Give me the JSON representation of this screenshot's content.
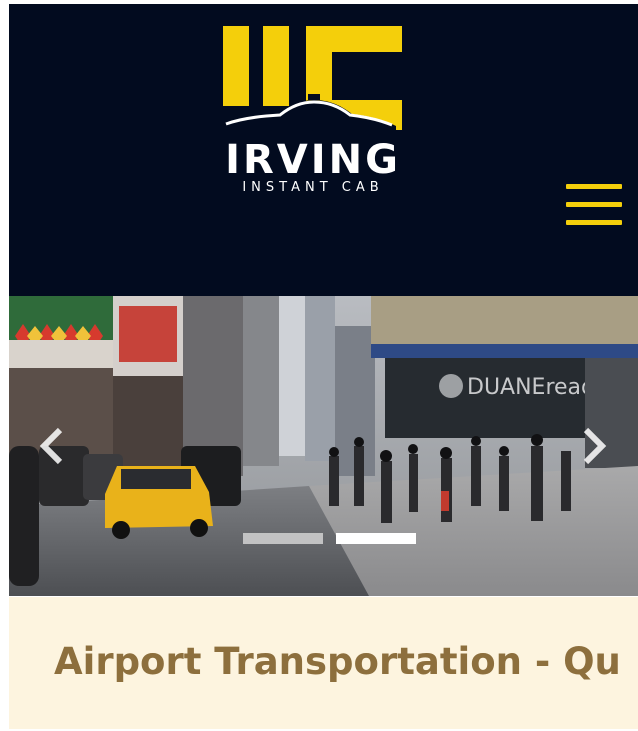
{
  "brand": {
    "logo_name": "IRVING",
    "logo_tagline": "INSTANT CAB",
    "accent_color": "#f4cf0b",
    "header_color": "#020b1f"
  },
  "nav": {
    "menu_icon": "hamburger-menu-icon"
  },
  "slider": {
    "store_sign": "DUANEreade",
    "prev_icon": "chevron-left-icon",
    "next_icon": "chevron-right-icon",
    "active_slide": 2,
    "slide_count": 2
  },
  "page": {
    "title": "Airport Transportation - Qu",
    "title_color": "#8d6f3d",
    "band_color": "#fdf4df"
  }
}
